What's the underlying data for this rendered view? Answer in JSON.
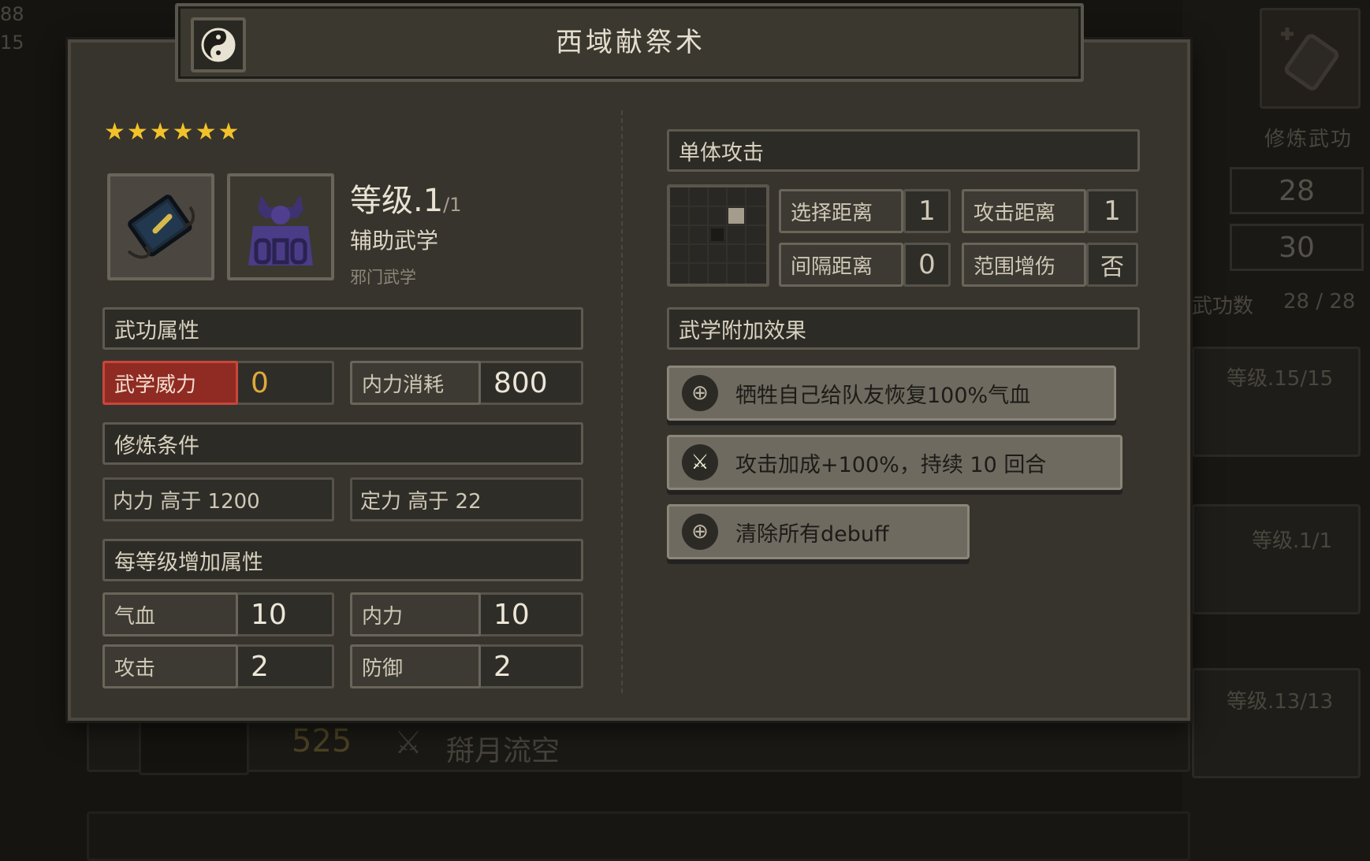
{
  "title": "西域献祭术",
  "stars": "★★★★★★",
  "level_label": "等级.1",
  "level_max": "/1",
  "category": "辅助武学",
  "sub_category": "邪门武学",
  "sections": {
    "attributes": "武功属性",
    "conditions": "修炼条件",
    "per_level": "每等级增加属性",
    "attack_type": "单体攻击",
    "effects_title": "武学附加效果"
  },
  "stats": {
    "power_label": "武学威力",
    "power_value": "0",
    "mp_cost_label": "内力消耗",
    "mp_cost_value": "800"
  },
  "conditions": [
    "内力 高于 1200",
    "定力 高于 22"
  ],
  "per_level": [
    {
      "label": "气血",
      "value": "10"
    },
    {
      "label": "内力",
      "value": "10"
    },
    {
      "label": "攻击",
      "value": "2"
    },
    {
      "label": "防御",
      "value": "2"
    }
  ],
  "range": {
    "select_label": "选择距离",
    "select_value": "1",
    "attack_label": "攻击距离",
    "attack_value": "1",
    "interval_label": "间隔距离",
    "interval_value": "0",
    "aoe_label": "范围增伤",
    "aoe_value": "否"
  },
  "effects": [
    "牺牲自己给队友恢复100%气血",
    "攻击加成+100%，持续 10 回合",
    "清除所有debuff"
  ],
  "background": {
    "right_label": "修炼武功",
    "box1": "28",
    "box2": "30",
    "count_label": "武功数",
    "count_value": "28 / 28",
    "level1": "等级.15/15",
    "level2": "等级.1/1",
    "level3": "等级.13/13",
    "bottom_number": "525",
    "bottom_name": "搿月流空",
    "top_left_nums": "88\n15"
  },
  "colors": {
    "panel": "#37342d",
    "accent_red": "#8f2b22",
    "star": "#f3c22a"
  }
}
